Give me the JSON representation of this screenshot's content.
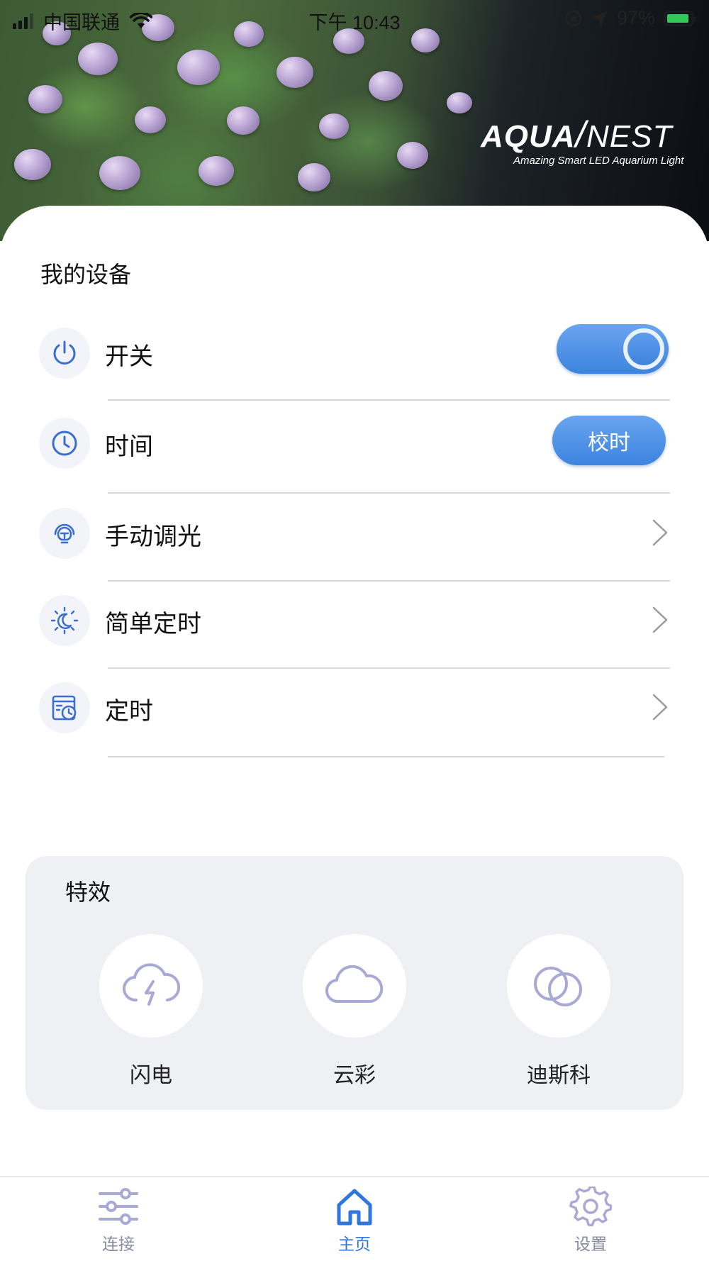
{
  "status_bar": {
    "carrier": "中国联通",
    "time": "下午 10:43",
    "battery": "97%"
  },
  "header": {
    "brand_bold": "AQUA",
    "brand_light": "NEST",
    "tagline": "Amazing Smart LED Aquarium Light"
  },
  "my_devices": {
    "title": "我的设备",
    "items": [
      {
        "label": "开关",
        "icon": "power-icon",
        "control": "toggle",
        "on": true
      },
      {
        "label": "时间",
        "icon": "clock-icon",
        "control": "button",
        "button_label": "校时"
      },
      {
        "label": "手动调光",
        "icon": "manual-dimming-icon",
        "control": "chevron"
      },
      {
        "label": "简单定时",
        "icon": "sun-moon-icon",
        "control": "chevron"
      },
      {
        "label": "定时",
        "icon": "schedule-icon",
        "control": "chevron"
      }
    ]
  },
  "effects": {
    "title": "特效",
    "items": [
      {
        "label": "闪电",
        "icon": "lightning-cloud-icon"
      },
      {
        "label": "云彩",
        "icon": "cloud-icon"
      },
      {
        "label": "迪斯科",
        "icon": "disco-icon"
      }
    ]
  },
  "tabbar": {
    "tabs": [
      {
        "label": "连接",
        "icon": "sliders-icon",
        "active": false
      },
      {
        "label": "主页",
        "icon": "home-icon",
        "active": true
      },
      {
        "label": "设置",
        "icon": "gear-icon",
        "active": false
      }
    ]
  },
  "colors": {
    "accent": "#3d83df",
    "icon_blue": "#3a6fd0",
    "effect_icon": "#a9a9d6",
    "tab_inactive": "#8a8aa0",
    "panel_bg": "#eef0f4"
  }
}
